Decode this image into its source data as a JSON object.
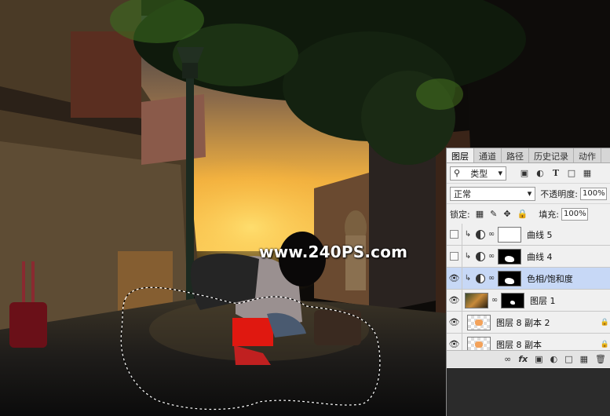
{
  "watermark": "www.240PS.com",
  "panel": {
    "tabs": [
      {
        "label": "图层",
        "active": true
      },
      {
        "label": "通道",
        "active": false
      },
      {
        "label": "路径",
        "active": false
      },
      {
        "label": "历史记录",
        "active": false
      },
      {
        "label": "动作",
        "active": false
      }
    ],
    "filter_kind": "类型",
    "filter_icons": [
      "image-filter-icon",
      "adjustment-filter-icon",
      "type-filter-icon",
      "shape-filter-icon",
      "smart-object-filter-icon"
    ],
    "blend_mode": "正常",
    "opacity_label": "不透明度:",
    "opacity_value": "100%",
    "lock_label": "锁定:",
    "fill_label": "填充:",
    "fill_value": "100%",
    "layers": [
      {
        "name": "曲线 5",
        "visible": false,
        "clipped": true,
        "type": "adjustment",
        "mask": "white",
        "selected": false
      },
      {
        "name": "曲线 4",
        "visible": false,
        "clipped": true,
        "type": "adjustment",
        "mask": "black-shape",
        "selected": false
      },
      {
        "name": "色相/饱和度",
        "visible": true,
        "clipped": true,
        "type": "adjustment",
        "mask": "black-shape",
        "selected": true
      },
      {
        "name": "图层 1",
        "visible": true,
        "clipped": false,
        "type": "pixel-with-mask",
        "mask": "black-small",
        "selected": false
      },
      {
        "name": "图层 8 副本 2",
        "visible": true,
        "clipped": false,
        "type": "pixel",
        "mask": "",
        "selected": false,
        "locked": true
      },
      {
        "name": "图层 8 副本",
        "visible": true,
        "clipped": false,
        "type": "pixel",
        "mask": "",
        "selected": false,
        "locked": true
      }
    ],
    "bottom_icons": [
      "link-layers-icon",
      "fx-icon",
      "add-mask-icon",
      "new-adjustment-icon",
      "new-group-icon",
      "new-layer-icon",
      "trash-icon"
    ]
  }
}
